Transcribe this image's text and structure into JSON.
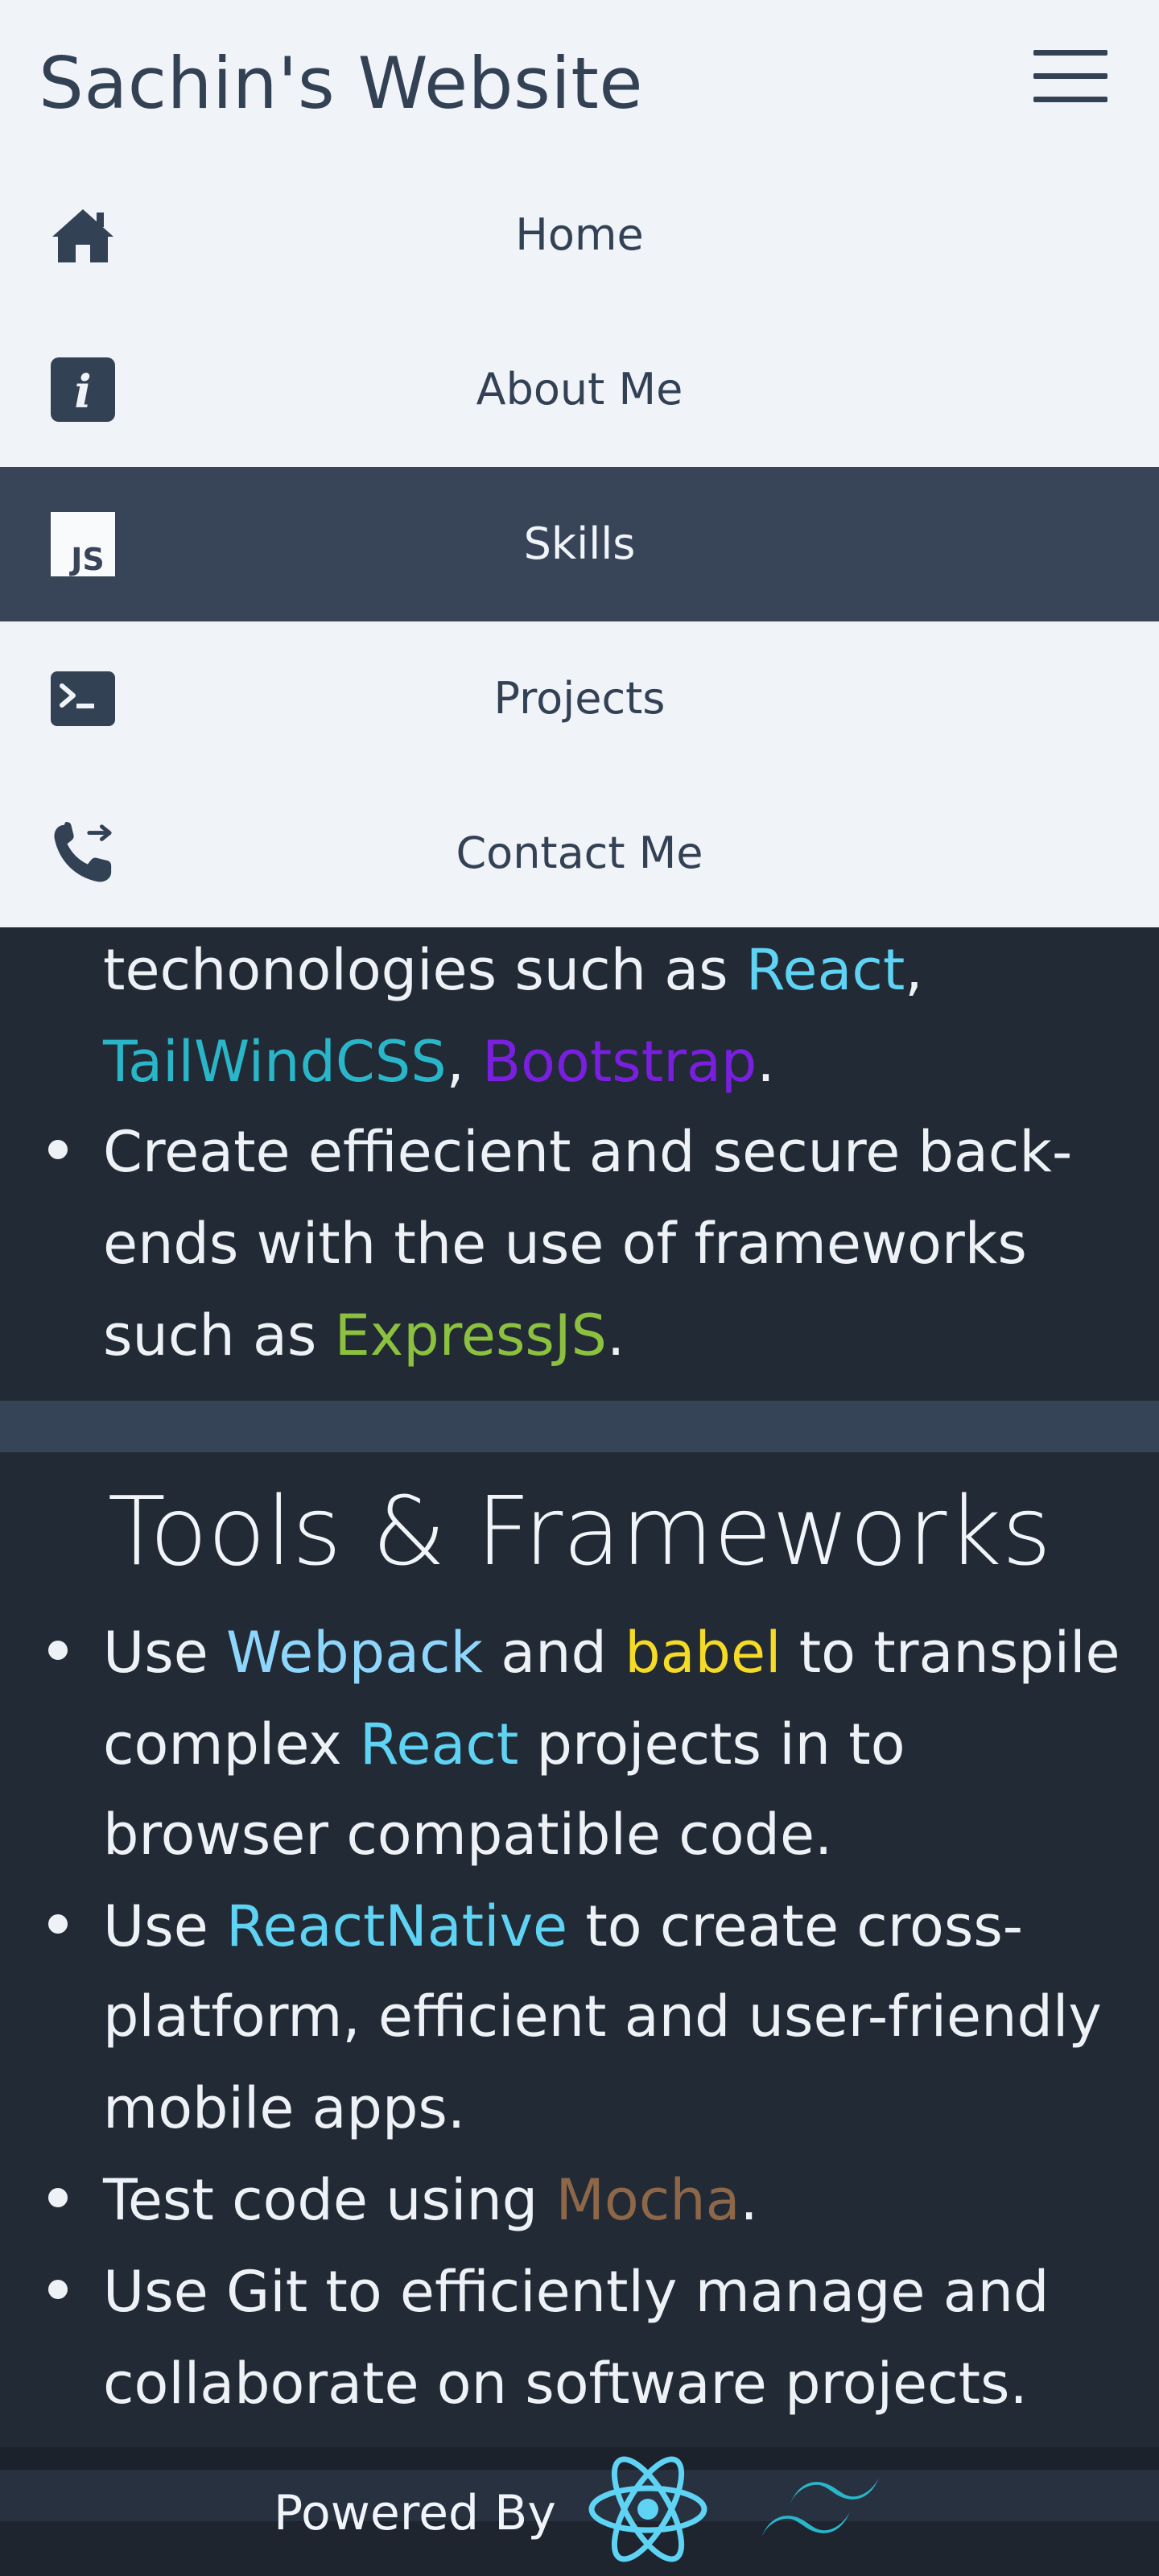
{
  "header": {
    "site_title": "Sachin's Website"
  },
  "nav": {
    "items": [
      {
        "label": "Home",
        "icon": "home-icon"
      },
      {
        "label": "About Me",
        "icon": "info-icon"
      },
      {
        "label": "Skills",
        "icon": "javascript-icon",
        "active": true
      },
      {
        "label": "Projects",
        "icon": "terminal-icon"
      },
      {
        "label": "Contact Me",
        "icon": "phone-forward-icon"
      }
    ]
  },
  "skills": {
    "intro_line1": {
      "pre": "techonologies such as ",
      "react": "React",
      "post": ","
    },
    "intro_line2": {
      "tailwind": "TailWindCSS",
      "sep": ", ",
      "bootstrap": "Bootstrap",
      "end": "."
    },
    "backend": {
      "line1": "Create effiecient and secure back-",
      "line2": "ends with the use of frameworks",
      "line3_pre": "such as ",
      "express": "ExpressJS",
      "line3_end": "."
    }
  },
  "tools": {
    "title": "Tools & Frameworks",
    "item1": {
      "pre": "Use ",
      "webpack": "Webpack",
      "and": " and ",
      "babel": "babel",
      "post": " to transpile",
      "line2_pre": "complex ",
      "react": "React",
      "line2_post": " projects in to",
      "line3": "browser compatible code."
    },
    "item2": {
      "pre": "Use ",
      "rn": "ReactNative",
      "post": " to create cross-",
      "line2": "platform, efficient and user-friendly",
      "line3": "mobile apps."
    },
    "item3": {
      "pre": "Test code using ",
      "mocha": "Mocha",
      "end": "."
    },
    "item4": {
      "line1": "Use Git to efficiently manage and",
      "line2": "collaborate on software projects."
    }
  },
  "footer": {
    "powered_by": "Powered By",
    "logos": [
      "react-logo-icon",
      "tailwind-logo-icon"
    ]
  },
  "colors": {
    "react": "#5fd3f3",
    "tailwind": "#2ab6c9",
    "bootstrap": "#7a1fe0",
    "express": "#8cc13f",
    "webpack": "#8ed6fb",
    "babel": "#f5da26",
    "mocha": "#8d6748",
    "nav_active": "#384559",
    "header_bg": "#f0f3f7",
    "page_bg": "#222a35"
  }
}
